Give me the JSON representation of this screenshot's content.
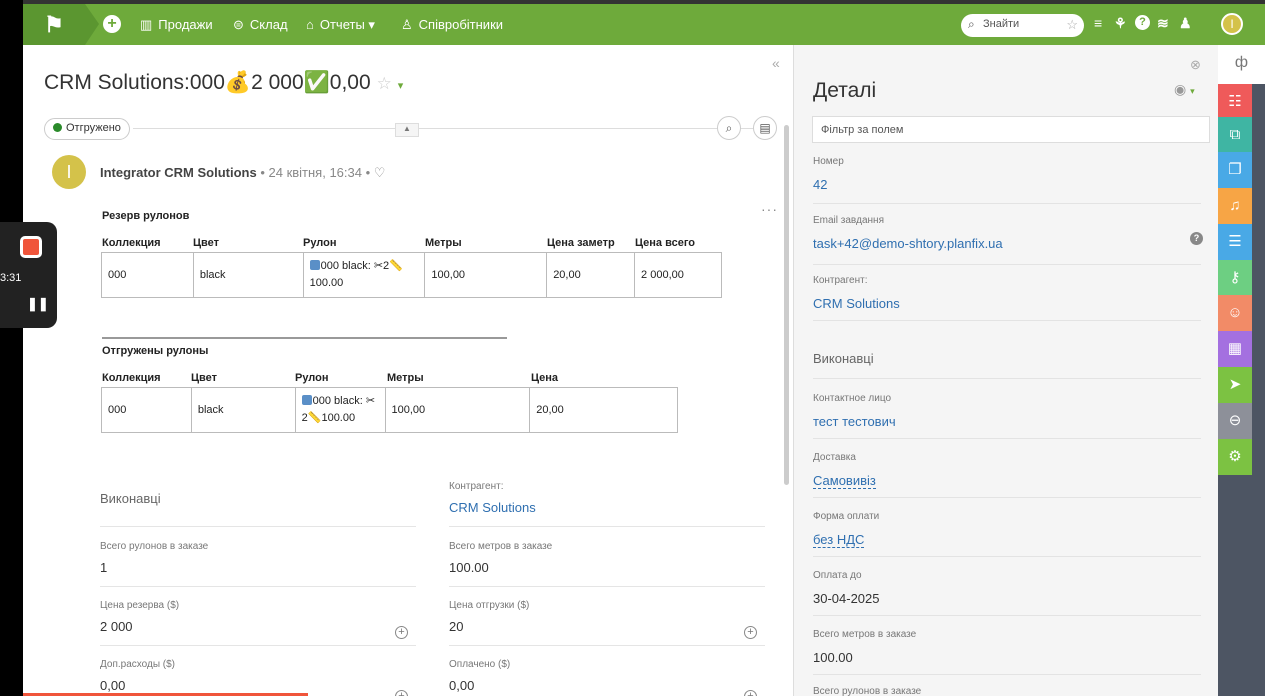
{
  "topbar": {
    "logo": "⚑",
    "nav": [
      {
        "icon": "▥",
        "label": "Продажи"
      },
      {
        "icon": "⊜",
        "label": "Склад"
      },
      {
        "icon": "⌂",
        "label": "Отчеты ▾"
      },
      {
        "icon": "♙",
        "label": "Співробітники"
      }
    ],
    "search_placeholder": "Знайти",
    "avatar_letter": "I"
  },
  "recorder": {
    "time": "3:31"
  },
  "task": {
    "title": "CRM Solutions:000💰2 000✅0,00",
    "status": "Отгружено"
  },
  "comment": {
    "avatar_letter": "I",
    "author": "Integrator CRM Solutions",
    "meta": " • 24 квітня, 16:34 • ♡",
    "reserve": {
      "title": "Резерв рулонов",
      "headers": [
        "Коллекция",
        "Цвет",
        "Рулон",
        "Метры",
        "Цена заметр",
        "Цена всего"
      ],
      "row": {
        "collection": "000",
        "color": "black",
        "roll_line1": "000 black: ✂2📏",
        "roll_line2": "100.00",
        "meters": "100,00",
        "price_per_meter": "20,00",
        "price_total": "2 000,00"
      }
    },
    "shipped": {
      "title": "Отгружены рулоны",
      "headers": [
        "Коллекция",
        "Цвет",
        "Рулон",
        "Метры",
        "Цена"
      ],
      "row": {
        "collection": "000",
        "color": "black",
        "roll_line1": "000 black: ✂",
        "roll_line2": "2📏100.00",
        "meters": "100,00",
        "price": "20,00"
      }
    }
  },
  "fields": {
    "left": [
      {
        "label": "",
        "value": "Виконавці"
      },
      {
        "label": "Всего рулонов в заказе",
        "value": "1"
      },
      {
        "label": "Цена резерва ($)",
        "value": "2 000"
      },
      {
        "label": "Доп.расходы ($)",
        "value": "0,00"
      }
    ],
    "right": [
      {
        "label": "Контрагент:",
        "value": "CRM Solutions"
      },
      {
        "label": "Всего метров в заказе",
        "value": "100.00"
      },
      {
        "label": "Цена отгрузки ($)",
        "value": "20"
      },
      {
        "label": "Оплачено ($)",
        "value": "0,00"
      }
    ]
  },
  "details": {
    "title": "Деталі",
    "filter_placeholder": "Фільтр за полем",
    "fields": [
      {
        "label": "Номер",
        "value": "42"
      },
      {
        "label": "Email завдання",
        "value": "task+42@demo-shtory.planfix.ua"
      },
      {
        "label": "Контрагент:",
        "value": "CRM Solutions"
      },
      {
        "label": "",
        "value": "Виконавці"
      },
      {
        "label": "Контактное лицо",
        "value": "тест тестович"
      },
      {
        "label": "Доставка",
        "value": "Самовивіз"
      },
      {
        "label": "Форма оплати",
        "value": "без НДС"
      },
      {
        "label": "Оплата до",
        "value": "30-04-2025"
      },
      {
        "label": "Всего метров в заказе",
        "value": "100.00"
      },
      {
        "label": "Всего рулонов в заказе",
        "value": ""
      }
    ]
  },
  "strip_colors": [
    "#ef5a5a",
    "#3fb5a3",
    "#49a9e6",
    "#f7a545",
    "#49a9e6",
    "#6dcf82",
    "#f28b67",
    "#a470e0",
    "#7cc242",
    "#8d9099",
    "#7cc242"
  ]
}
